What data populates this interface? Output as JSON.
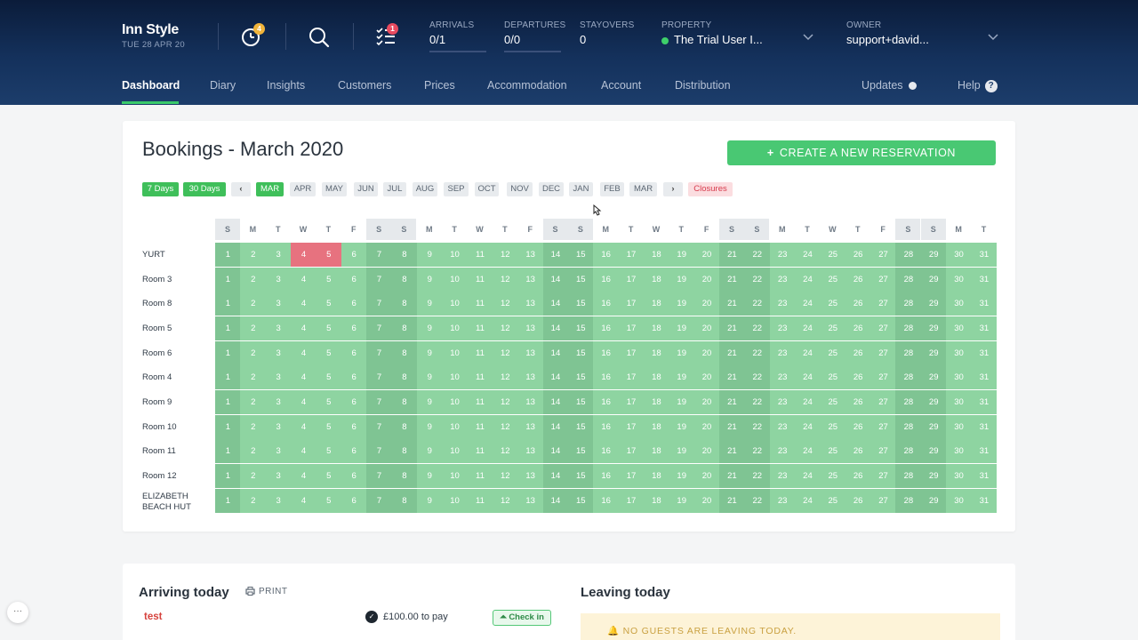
{
  "brand": {
    "name": "Inn Style",
    "date": "TUE 28 APR 20"
  },
  "header": {
    "timer_badge": "4",
    "tasks_badge": "1",
    "arrivals": {
      "label": "ARRIVALS",
      "value": "0/1"
    },
    "departures": {
      "label": "DEPARTURES",
      "value": "0/0"
    },
    "stayovers": {
      "label": "STAYOVERS",
      "value": "0"
    },
    "property": {
      "label": "PROPERTY",
      "value": "The Trial User I..."
    },
    "owner": {
      "label": "OWNER",
      "value": "support+david..."
    }
  },
  "nav": {
    "items": [
      "Dashboard",
      "Diary",
      "Insights",
      "Customers",
      "Prices",
      "Accommodation",
      "Account",
      "Distribution"
    ],
    "active": "Dashboard",
    "updates": "Updates",
    "help": "Help",
    "help_glyph": "?"
  },
  "bookings": {
    "title": "Bookings - March 2020",
    "create_button": "CREATE A NEW RESERVATION",
    "create_plus": "+",
    "range_buttons": [
      "7 Days",
      "30 Days"
    ],
    "prev_glyph": "‹",
    "next_glyph": "›",
    "months": [
      "MAR",
      "APR",
      "MAY",
      "JUN",
      "JUL",
      "AUG",
      "SEP",
      "OCT",
      "NOV",
      "DEC",
      "JAN",
      "FEB",
      "MAR"
    ],
    "selected_month_index": 0,
    "closures": "Closures",
    "weekday_initials": [
      "S",
      "M",
      "T",
      "W",
      "T",
      "F",
      "S",
      "S",
      "M",
      "T",
      "W",
      "T",
      "F",
      "S",
      "S",
      "M",
      "T",
      "W",
      "T",
      "F",
      "S",
      "S",
      "M",
      "T",
      "W",
      "T",
      "F",
      "S",
      "S",
      "M",
      "T"
    ],
    "weekend_days": [
      1,
      7,
      8,
      14,
      15,
      21,
      22,
      28,
      29
    ],
    "days": [
      1,
      2,
      3,
      4,
      5,
      6,
      7,
      8,
      9,
      10,
      11,
      12,
      13,
      14,
      15,
      16,
      17,
      18,
      19,
      20,
      21,
      22,
      23,
      24,
      25,
      26,
      27,
      28,
      29,
      30,
      31
    ],
    "rooms": [
      {
        "name": "YURT",
        "booked": [
          4,
          5
        ]
      },
      {
        "name": "Room 3",
        "booked": []
      },
      {
        "name": "Room 8",
        "booked": []
      },
      {
        "name": "Room 5",
        "booked": []
      },
      {
        "name": "Room 6",
        "booked": []
      },
      {
        "name": "Room 4",
        "booked": []
      },
      {
        "name": "Room 9",
        "booked": []
      },
      {
        "name": "Room 10",
        "booked": []
      },
      {
        "name": "Room 11",
        "booked": []
      },
      {
        "name": "Room 12",
        "booked": []
      },
      {
        "name": "ELIZABETH BEACH HUT",
        "booked": []
      }
    ],
    "colors": {
      "available": "#8ed4a1",
      "available_weekend": "#7fc493",
      "booked": "#e7727f"
    }
  },
  "arriving": {
    "title": "Arriving today",
    "print": "PRINT",
    "guest": "test",
    "payment": "£100.00 to pay",
    "checkin": "Check in"
  },
  "leaving": {
    "title": "Leaving today",
    "message": "NO GUESTS ARE LEAVING TODAY."
  },
  "fab_glyph": "···"
}
